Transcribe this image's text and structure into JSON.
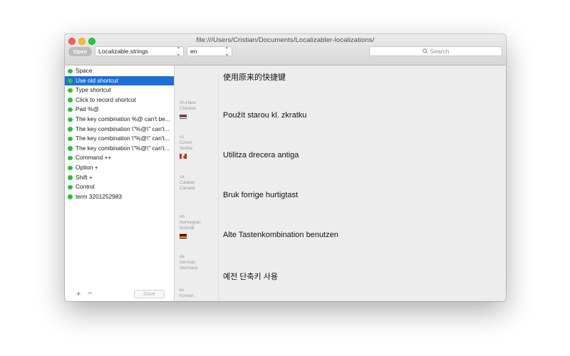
{
  "window": {
    "title": "file:///Users/Cristian/Documents/Localizabler-localizations/"
  },
  "toolbar": {
    "open_label": "Open",
    "file_select": "Localizable.strings",
    "language_select": "en",
    "search_placeholder": "Search"
  },
  "sidebar": {
    "items": [
      {
        "label": "Space",
        "status": "green",
        "selected": false
      },
      {
        "label": "Use old shortcut",
        "status": "green",
        "selected": true
      },
      {
        "label": "Type shortcut",
        "status": "green",
        "selected": false
      },
      {
        "label": "Click to record shortcut",
        "status": "green",
        "selected": false
      },
      {
        "label": "Pad %@",
        "status": "green",
        "selected": false
      },
      {
        "label": "The key combination %@ can't be...",
        "status": "green",
        "selected": false
      },
      {
        "label": "The key combination \\\"%@\\\" can't...",
        "status": "green",
        "selected": false
      },
      {
        "label": "The key combination \\\"%@\\\" can't...",
        "status": "green",
        "selected": false
      },
      {
        "label": "The key combination \\\"%@\\\" can't...",
        "status": "green",
        "selected": false
      },
      {
        "label": "Command ++",
        "status": "green",
        "selected": false
      },
      {
        "label": "Option +",
        "status": "green",
        "selected": false
      },
      {
        "label": "Shift +",
        "status": "green",
        "selected": false
      },
      {
        "label": "Control",
        "status": "green",
        "selected": false
      },
      {
        "label": "term 3201252983",
        "status": "green",
        "selected": false
      }
    ],
    "add_symbol": "+",
    "remove_symbol": "−",
    "save_label": "Save"
  },
  "translations": [
    {
      "code": "zh-Hans",
      "language": "Chinese",
      "region": "",
      "flag": "",
      "text": "使用原来的快捷键"
    },
    {
      "code": "cs",
      "language": "Czech",
      "region": "Serbia",
      "flag": "flag-rs",
      "text": "Použít starou kl. zkratku"
    },
    {
      "code": "ca",
      "language": "Catalan",
      "region": "Canada",
      "flag": "flag-ca",
      "text": "Utilitza drecera antiga"
    },
    {
      "code": "nb",
      "language": "Norwegian",
      "region": "Bokmål",
      "flag": "",
      "text": "Bruk forrige hurtigtast"
    },
    {
      "code": "de",
      "language": "German",
      "region": "Germany",
      "flag": "flag-de",
      "text": "Alte Tastenkombination benutzen"
    },
    {
      "code": "ko",
      "language": "Korean",
      "region": "",
      "flag": "",
      "text": "예전 단축키 사용"
    }
  ],
  "colors": {
    "selection": "#1e6fd6",
    "status_green": "#2fbd3e"
  }
}
